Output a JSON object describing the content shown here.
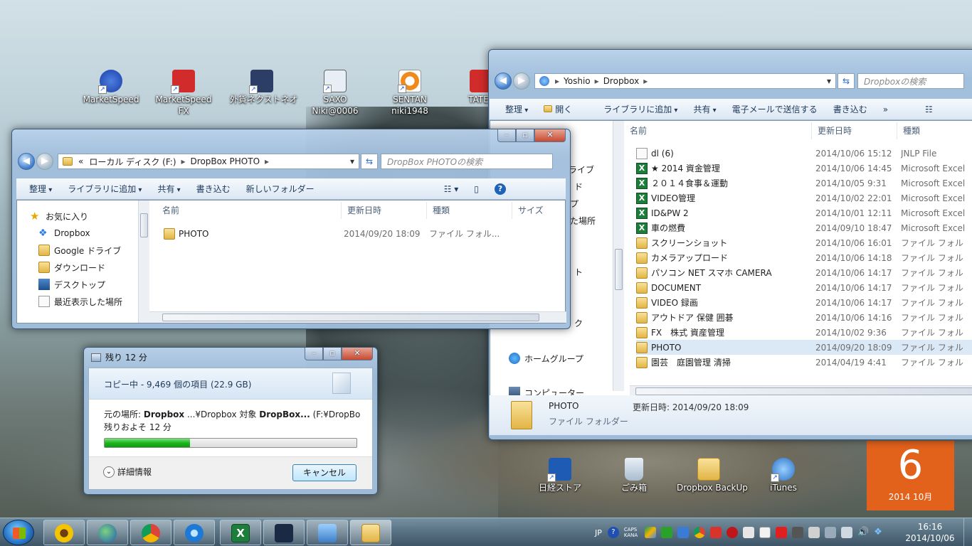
{
  "desktop_icons": [
    {
      "label": "MarketSpeed",
      "color": "#1a3fa8"
    },
    {
      "label": "MarketSpeed FX",
      "color": "#d12b2b"
    },
    {
      "label": "外貨ネクストネオ",
      "color": "#2c3e66"
    },
    {
      "label": "SAXO Niki@0006",
      "color": "#e8eef5"
    },
    {
      "label": "SENTAN niki1948",
      "color": "#f08a1c"
    },
    {
      "label": "TATE niki",
      "color": "#d12b2b"
    },
    {
      "label": "日経ストア",
      "color": "#1d5bb5"
    },
    {
      "label": "ごみ箱",
      "color": "#c9d6e4"
    },
    {
      "label": "Dropbox BackUp",
      "color": "#e7c05a"
    },
    {
      "label": "iTunes",
      "color": "#3e8fe0"
    }
  ],
  "left_window": {
    "address": [
      "«",
      "ローカル ディスク (F:)",
      "▸",
      "DropBox PHOTO",
      "▸"
    ],
    "search_placeholder": "DropBox PHOTOの検索",
    "toolbar": {
      "organize": "整理",
      "add_library": "ライブラリに追加",
      "share": "共有",
      "burn": "書き込む",
      "new_folder": "新しいフォルダー"
    },
    "nav": [
      "お気に入り",
      "Dropbox",
      "Google ドライブ",
      "ダウンロード",
      "デスクトップ",
      "最近表示した場所"
    ],
    "columns": [
      "名前",
      "更新日時",
      "種類",
      "サイズ"
    ],
    "rows": [
      {
        "name": "PHOTO",
        "date": "2014/09/20 18:09",
        "type": "ファイル フォル..."
      }
    ]
  },
  "right_window": {
    "address": [
      "Yoshio",
      "▸",
      "Dropbox",
      "▸"
    ],
    "search_placeholder": "Dropboxの検索",
    "toolbar": {
      "organize": "整理",
      "open": "開く",
      "add_library": "ライブラリに追加",
      "share": "共有",
      "email": "電子メールで送信する",
      "burn": "書き込む",
      "more": "»"
    },
    "nav_partial": [
      "ライブ",
      "ド",
      "プ",
      "た場所",
      "ト",
      "ク"
    ],
    "nav": [
      "ホームグループ",
      "コンピューター"
    ],
    "columns": [
      "名前",
      "更新日時",
      "種類"
    ],
    "rows": [
      {
        "name": "dl (6)",
        "date": "2014/10/06 15:12",
        "type": "JNLP File",
        "icon": "file"
      },
      {
        "name": "★ 2014 資金管理",
        "date": "2014/10/06 14:45",
        "type": "Microsoft Excel",
        "icon": "xl"
      },
      {
        "name": "２０１４食事＆運動",
        "date": "2014/10/05 9:31",
        "type": "Microsoft Excel",
        "icon": "xl"
      },
      {
        "name": "VIDEO管理",
        "date": "2014/10/02 22:01",
        "type": "Microsoft Excel",
        "icon": "xl"
      },
      {
        "name": "ID&PW 2",
        "date": "2014/10/01 12:11",
        "type": "Microsoft Excel",
        "icon": "xl"
      },
      {
        "name": "車の燃費",
        "date": "2014/09/10 18:47",
        "type": "Microsoft Excel",
        "icon": "xl"
      },
      {
        "name": "スクリーンショット",
        "date": "2014/10/06 16:01",
        "type": "ファイル フォル",
        "icon": "folder"
      },
      {
        "name": "カメラアップロード",
        "date": "2014/10/06 14:18",
        "type": "ファイル フォル",
        "icon": "folder"
      },
      {
        "name": "パソコン NET スマホ CAMERA",
        "date": "2014/10/06 14:17",
        "type": "ファイル フォル",
        "icon": "folder"
      },
      {
        "name": "DOCUMENT",
        "date": "2014/10/06 14:17",
        "type": "ファイル フォル",
        "icon": "folder"
      },
      {
        "name": "VIDEO 録画",
        "date": "2014/10/06 14:17",
        "type": "ファイル フォル",
        "icon": "folder"
      },
      {
        "name": "アウトドア 保健 囲碁",
        "date": "2014/10/06 14:16",
        "type": "ファイル フォル",
        "icon": "folder"
      },
      {
        "name": "FX　株式 資産管理",
        "date": "2014/10/02 9:36",
        "type": "ファイル フォル",
        "icon": "folder"
      },
      {
        "name": "PHOTO",
        "date": "2014/09/20 18:09",
        "type": "ファイル フォル",
        "icon": "folder",
        "selected": true
      },
      {
        "name": "園芸　庭園管理 清掃",
        "date": "2014/04/19 4:41",
        "type": "ファイル フォル",
        "icon": "folder"
      }
    ],
    "details": {
      "name": "PHOTO",
      "modified": "更新日時: 2014/09/20 18:09",
      "type": "ファイル フォルダー"
    }
  },
  "copy_dialog": {
    "title": "残り 12 分",
    "header": "コピー中 - 9,469 個の項目 (22.9 GB)",
    "from_label": "元の場所: ",
    "from_value": "Dropbox",
    "to_prefix": " ...¥Dropbox 対象 ",
    "to_value": "DropBox...",
    "to_path": " (F:¥DropBox",
    "remaining": "残りおよそ 12 分",
    "progress": 0.34,
    "details": "詳細情報",
    "cancel": "キャンセル"
  },
  "calendar": {
    "day": "6",
    "year_month": "2014 10月"
  },
  "taskbar": {
    "tray_lang": "JP",
    "caps": "CAPS",
    "kana": "KANA",
    "time": "16:16",
    "date": "2014/10/06"
  }
}
